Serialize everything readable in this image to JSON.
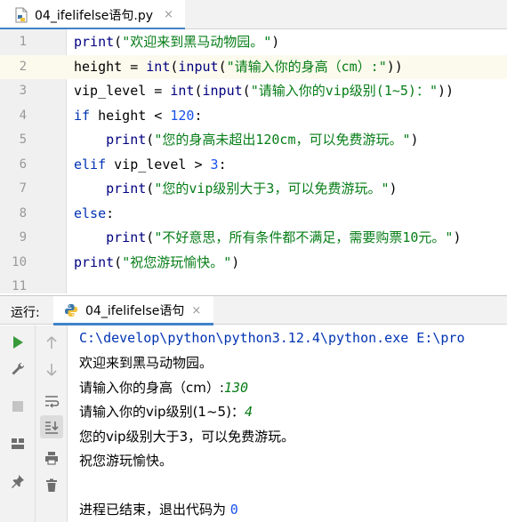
{
  "editor_tab": {
    "label": "04_ifelifelse语句.py",
    "close": "×"
  },
  "code_lines": [
    {
      "n": "1"
    },
    {
      "n": "2"
    },
    {
      "n": "3"
    },
    {
      "n": "4"
    },
    {
      "n": "5"
    },
    {
      "n": "6"
    },
    {
      "n": "7"
    },
    {
      "n": "8"
    },
    {
      "n": "9"
    },
    {
      "n": "10"
    },
    {
      "n": "11"
    }
  ],
  "code": {
    "l1": {
      "fn": "print",
      "open": "(",
      "s": "\"欢迎来到黑马动物园。\"",
      "close": ")"
    },
    "l2": {
      "var": "height",
      "eq": " = ",
      "fn1": "int",
      "p1": "(",
      "fn2": "input",
      "p2": "(",
      "s": "\"请输入你的身高（cm）:\"",
      "close": "))"
    },
    "l3": {
      "var": "vip_level",
      "eq": " = ",
      "fn1": "int",
      "p1": "(",
      "fn2": "input",
      "p2": "(",
      "s": "\"请输入你的vip级别(1~5)：\"",
      "close": "))"
    },
    "l4": {
      "kw": "if",
      "rest": " height < ",
      "num": "120",
      "colon": ":"
    },
    "l5": {
      "indent": "    ",
      "fn": "print",
      "open": "(",
      "s": "\"您的身高未超出120cm，可以免费游玩。\"",
      "close": ")"
    },
    "l6": {
      "kw": "elif",
      "rest": " vip_level > ",
      "num": "3",
      "colon": ":"
    },
    "l7": {
      "indent": "    ",
      "fn": "print",
      "open": "(",
      "s": "\"您的vip级别大于3，可以免费游玩。\"",
      "close": ")"
    },
    "l8": {
      "kw": "else",
      "colon": ":"
    },
    "l9": {
      "indent": "    ",
      "fn": "print",
      "open": "(",
      "s": "\"不好意思，所有条件都不满足，需要购票10元。\"",
      "close": ")"
    },
    "l10": {
      "fn": "print",
      "open": "(",
      "s": "\"祝您游玩愉快。\"",
      "close": ")"
    }
  },
  "run_window": {
    "label": "运行:",
    "tab_label": "04_ifelifelse语句",
    "tab_close": "×"
  },
  "console": {
    "command": "C:\\develop\\python\\python3.12.4\\python.exe E:\\pro",
    "line1": "欢迎来到黑马动物园。",
    "prompt_height": "请输入你的身高（cm）:",
    "input_height": "130",
    "prompt_vip": "请输入你的vip级别(1~5)：",
    "input_vip": "4",
    "line_result": "您的vip级别大于3，可以免费游玩。",
    "line_bye": "祝您游玩愉快。",
    "exit_text": "进程已结束，退出代码为 ",
    "exit_code": "0"
  },
  "icons": [
    "python-file-icon",
    "python-icon",
    "run-icon",
    "wrench-icon",
    "stop-icon",
    "layout-icon",
    "pin-icon",
    "up-arrow-icon",
    "down-arrow-icon",
    "soft-wrap-icon",
    "scroll-to-end-icon",
    "print-icon",
    "trash-icon"
  ],
  "colors": {
    "keyword": "#0033b3",
    "string": "#067d17",
    "number": "#1750eb",
    "accent": "#4083c9",
    "run_green": "#3a9a3a"
  }
}
